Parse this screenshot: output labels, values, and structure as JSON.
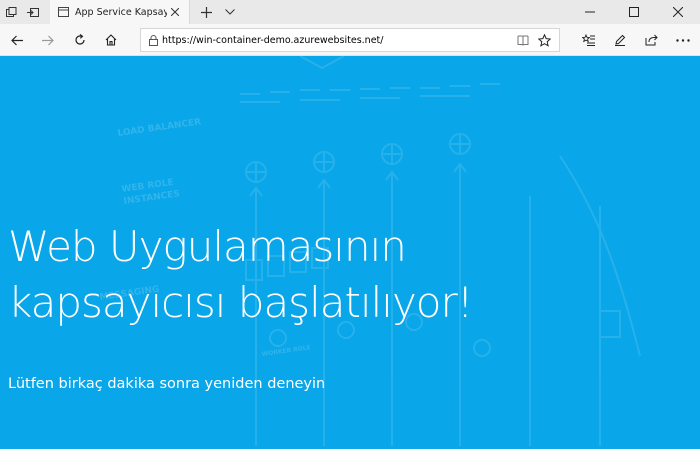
{
  "browser": {
    "tab": {
      "title": "App Service Kapsayıcısı"
    },
    "address": {
      "url": "https://win-container-demo.azurewebsites.net/"
    }
  },
  "page": {
    "headline_line1": "Web Uygulamasının",
    "headline_line2": "kapsayıcısı başlatılıyor!",
    "subtext": "Lütfen birkaç dakika sonra yeniden deneyin",
    "bg_labels": {
      "load_balancer": "LOAD BALANCER",
      "web_role": "WEB ROLE",
      "instances": "INSTANCES",
      "messaging": "MESSAGING",
      "worker_role": "WORKER ROLE"
    }
  },
  "colors": {
    "page_background": "#09a6e9",
    "text": "#ffffff",
    "chrome": "#f7f7f7"
  },
  "icons": [
    "tab-manager-icon",
    "set-aside-tabs-icon",
    "page-icon",
    "close-icon",
    "plus-icon",
    "chevron-down-icon",
    "minimize-icon",
    "maximize-icon",
    "window-close-icon",
    "back-arrow-icon",
    "forward-arrow-icon",
    "refresh-icon",
    "home-icon",
    "lock-icon",
    "reading-view-icon",
    "favorite-star-icon",
    "favorites-list-icon",
    "notes-pen-icon",
    "share-icon",
    "more-icon"
  ]
}
